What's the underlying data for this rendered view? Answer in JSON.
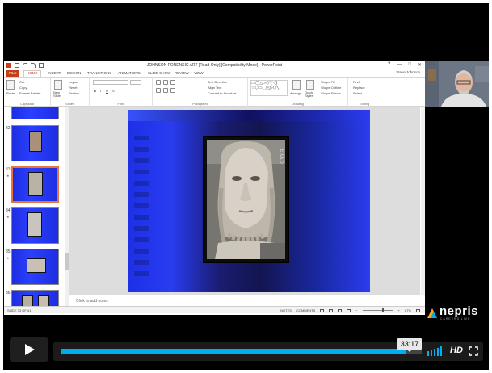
{
  "window": {
    "title": "JOHNSON FORENSIC ART [Read-Only] [Compatibility Mode] - PowerPoint",
    "user": "Steve Johnson",
    "controls": [
      "?",
      "—",
      "□",
      "✕"
    ]
  },
  "tabs": [
    {
      "label": "FILE"
    },
    {
      "label": "HOME"
    },
    {
      "label": "INSERT"
    },
    {
      "label": "DESIGN"
    },
    {
      "label": "TRANSITIONS"
    },
    {
      "label": "ANIMATIONS"
    },
    {
      "label": "SLIDE SHOW"
    },
    {
      "label": "REVIEW"
    },
    {
      "label": "VIEW"
    }
  ],
  "ribbon": {
    "clipboard": {
      "paste": "Paste",
      "cut": "Cut",
      "copy": "Copy",
      "format_painter": "Format Painter",
      "label": "Clipboard"
    },
    "slides": {
      "new_slide": "New Slide",
      "layout": "Layout",
      "reset": "Reset",
      "section": "Section",
      "label": "Slides"
    },
    "font": {
      "bold": "B",
      "italic": "I",
      "underline": "U",
      "strike": "S",
      "label": "Font"
    },
    "paragraph": {
      "text_direction": "Text Direction",
      "align_text": "Align Text",
      "smartart": "Convert to SmartArt",
      "label": "Paragraph"
    },
    "drawing": {
      "arrange": "Arrange",
      "quick_styles": "Quick Styles",
      "shape_fill": "Shape Fill",
      "shape_outline": "Shape Outline",
      "shape_effects": "Shape Effects",
      "label": "Drawing"
    },
    "editing": {
      "find": "Find",
      "replace": "Replace",
      "select": "Select",
      "label": "Editing"
    }
  },
  "thumbnails": [
    {
      "num": "32"
    },
    {
      "num": "33"
    },
    {
      "num": "34"
    },
    {
      "num": "35"
    },
    {
      "num": "36"
    }
  ],
  "slide": {
    "photo_label": "ERA 5"
  },
  "notes": {
    "placeholder": "Click to add notes"
  },
  "status": {
    "slide_indicator": "SLIDE 33 OF 41",
    "notes": "NOTES",
    "comments": "COMMENTS",
    "zoom": "87%"
  },
  "player": {
    "brand": "nepris",
    "brand_sub": "CAREERS LIVE",
    "time": "33:17",
    "hd": "HD",
    "progress": 0.955,
    "volume_bars": 5
  }
}
